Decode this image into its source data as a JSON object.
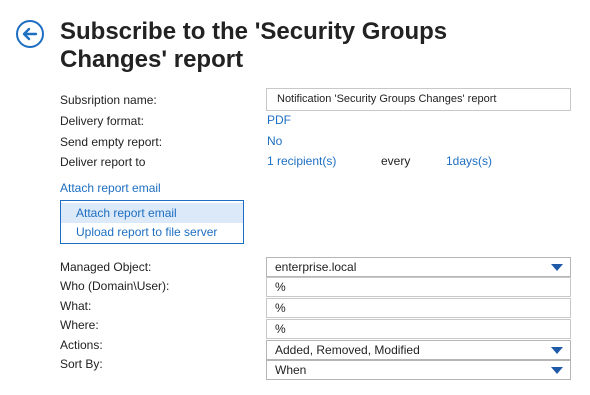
{
  "header": {
    "title": "Subscribe to the 'Security Groups Changes' report"
  },
  "form": {
    "subscription_name_label": "Subsription name:",
    "subscription_name_value": "Notification 'Security Groups Changes' report",
    "delivery_format_label": "Delivery format:",
    "delivery_format_value": "PDF",
    "send_empty_label": "Send empty report:",
    "send_empty_value": "No",
    "deliver_to_label": "Deliver report to",
    "recipients_value": "1 recipient(s)",
    "every_label": "every",
    "interval_value": "1days(s)"
  },
  "attach": {
    "link_label": "Attach report email",
    "options": [
      "Attach report email",
      "Upload report to file server"
    ],
    "selected_index": 0
  },
  "filters": {
    "managed_object_label": "Managed Object:",
    "managed_object_value": "enterprise.local",
    "who_label": "Who (Domain\\User):",
    "who_value": "%",
    "what_label": "What:",
    "what_value": "%",
    "where_label": "Where:",
    "where_value": "%",
    "actions_label": "Actions:",
    "actions_value": "Added, Removed, Modified",
    "sort_by_label": "Sort By:",
    "sort_by_value": "When"
  },
  "icons": {
    "back": "back-arrow-icon",
    "dropdown": "chevron-down-icon"
  },
  "colors": {
    "accent": "#1e6fc2",
    "menu_selected_bg": "#dbe9f8",
    "caret": "#1e5aa8"
  }
}
